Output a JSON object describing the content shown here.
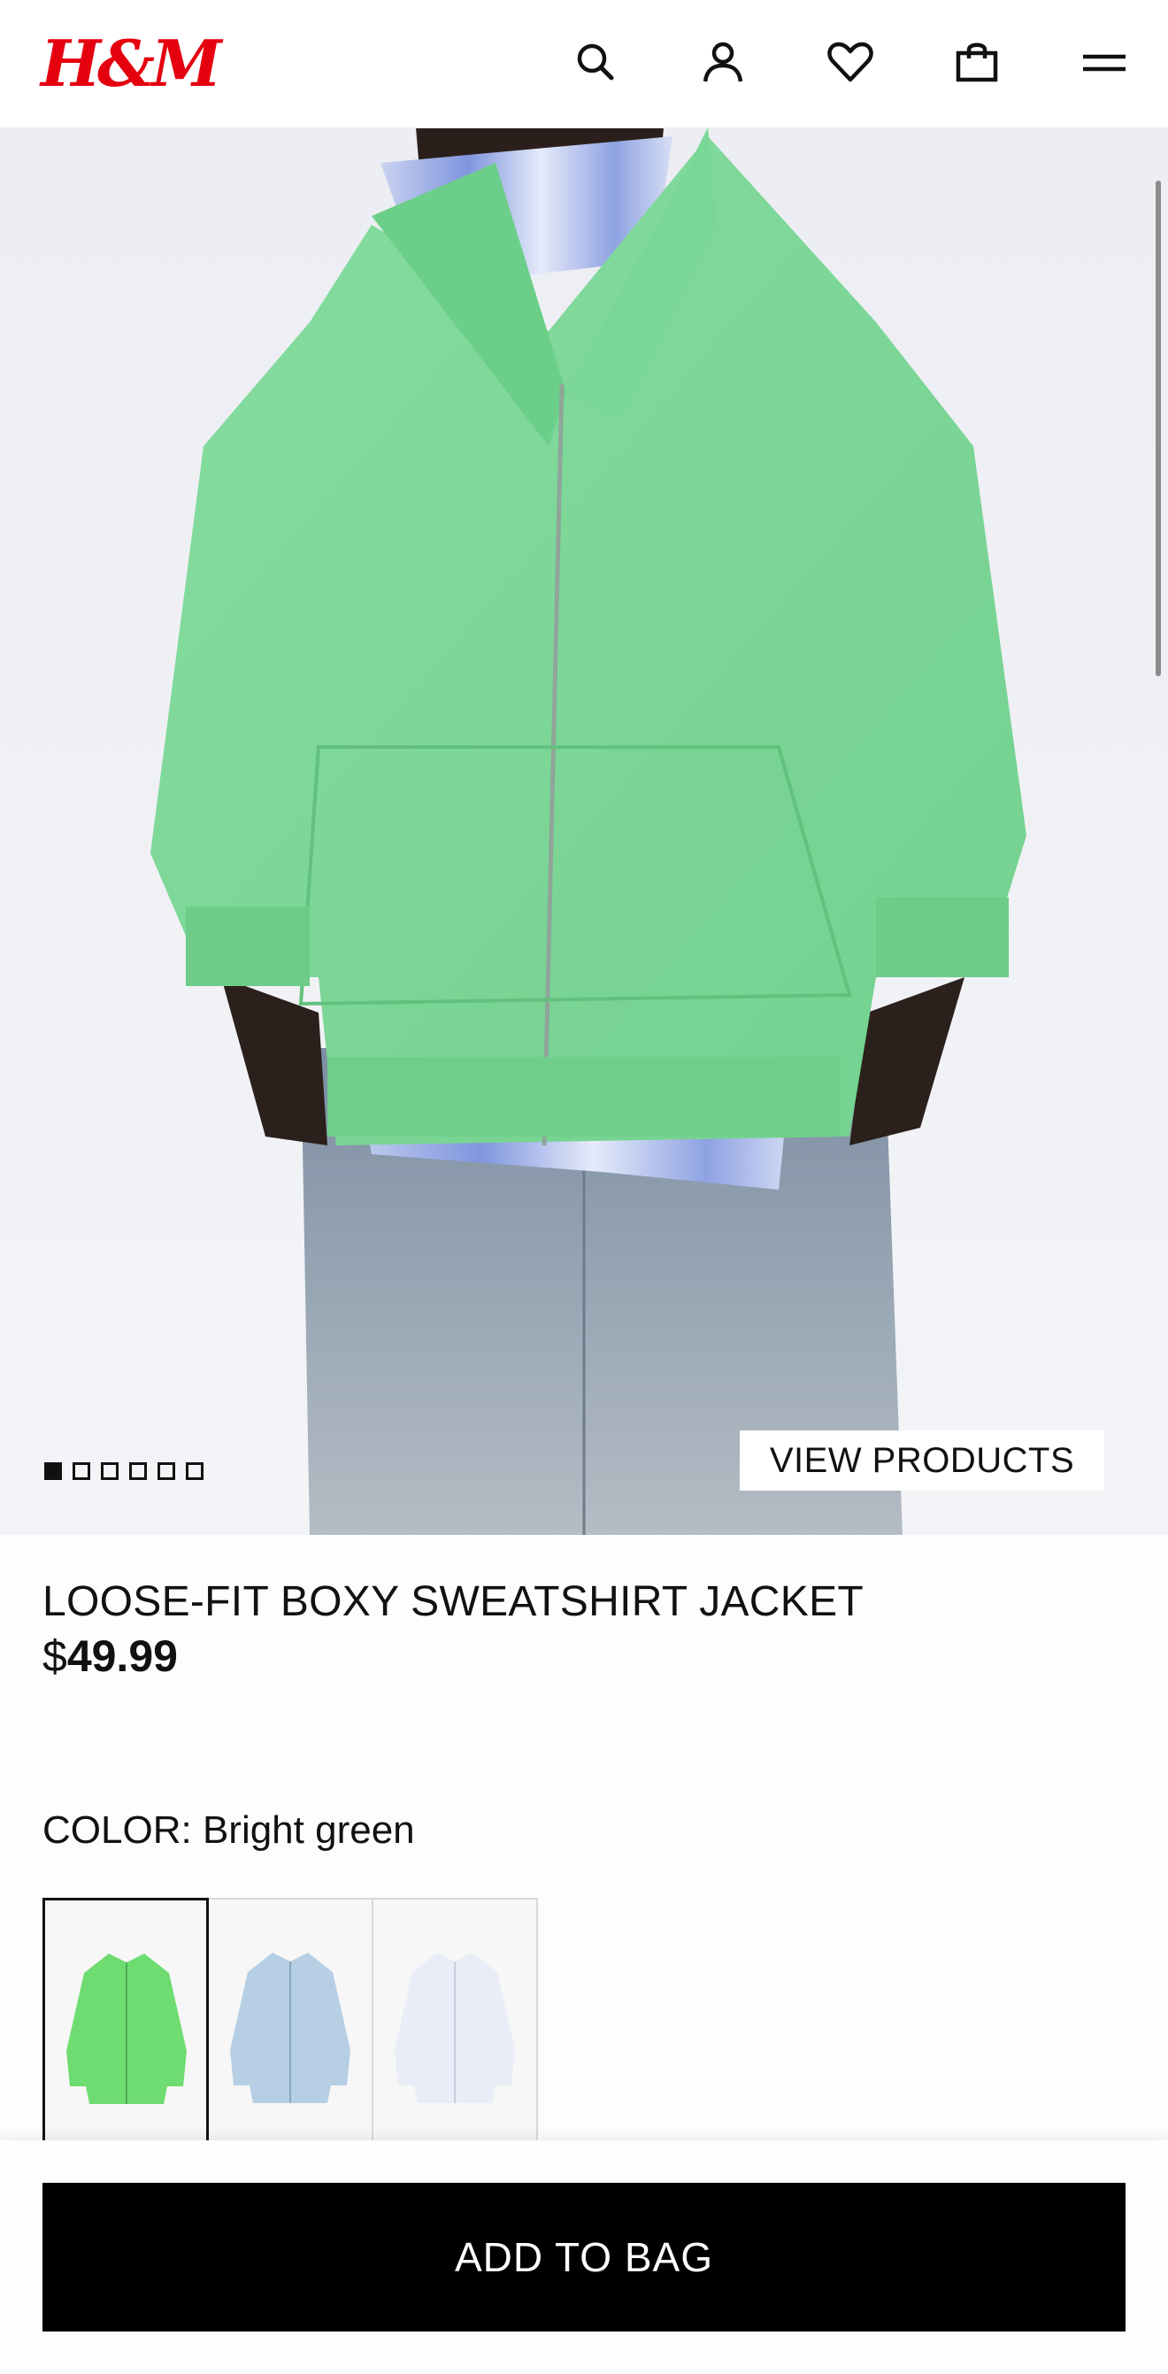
{
  "header": {
    "logo": "H&M",
    "icons": [
      "search-icon",
      "account-icon",
      "favorites-heart-icon",
      "shopping-bag-icon",
      "menu-icon"
    ]
  },
  "hero": {
    "view_products_label": "VIEW PRODUCTS",
    "image_count": 6,
    "active_index": 0
  },
  "product": {
    "title": "LOOSE-FIT BOXY SWEATSHIRT JACKET",
    "currency": "$",
    "price": "49.99",
    "color_label": "COLOR:",
    "color_value": "Bright green",
    "swatches": [
      {
        "color": "#6fdc71",
        "selected": true
      },
      {
        "color": "#b6cfe4",
        "selected": false
      },
      {
        "color": "#e8edf7",
        "selected": false
      }
    ]
  },
  "actions": {
    "add_to_bag_label": "ADD TO BAG"
  },
  "colors": {
    "brand_red": "#e50010",
    "jacket_green": "#7dd798",
    "button_black": "#000000"
  }
}
